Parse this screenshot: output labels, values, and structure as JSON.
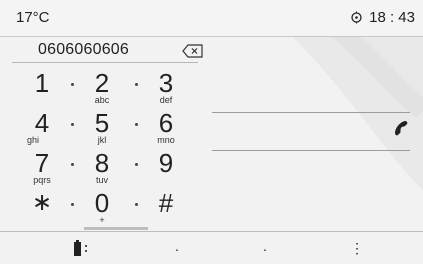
{
  "status": {
    "temperature": "17°C",
    "time": "18 : 43",
    "clock_icon": "clock-icon"
  },
  "dialer": {
    "number": "0606060606",
    "backspace_icon": "backspace-icon"
  },
  "keypad": [
    {
      "digit": "1",
      "letters": ""
    },
    {
      "digit": "2",
      "letters": "abc"
    },
    {
      "digit": "3",
      "letters": "def"
    },
    {
      "digit": "4",
      "letters": "ghi"
    },
    {
      "digit": "5",
      "letters": "jkl"
    },
    {
      "digit": "6",
      "letters": "mno"
    },
    {
      "digit": "7",
      "letters": "pqrs"
    },
    {
      "digit": "8",
      "letters": "tuv"
    },
    {
      "digit": "9",
      "letters": ""
    },
    {
      "digit": "∗",
      "letters": ""
    },
    {
      "digit": "0",
      "letters": "+"
    },
    {
      "digit": "#",
      "letters": ""
    }
  ],
  "call": {
    "icon": "phone-handset-icon"
  },
  "softkeys": {
    "battery_icon": "battery-icon",
    "menu_icon": "menu-dots-icon",
    "item_2": "·",
    "item_3": "·",
    "item_4": "⋮"
  }
}
